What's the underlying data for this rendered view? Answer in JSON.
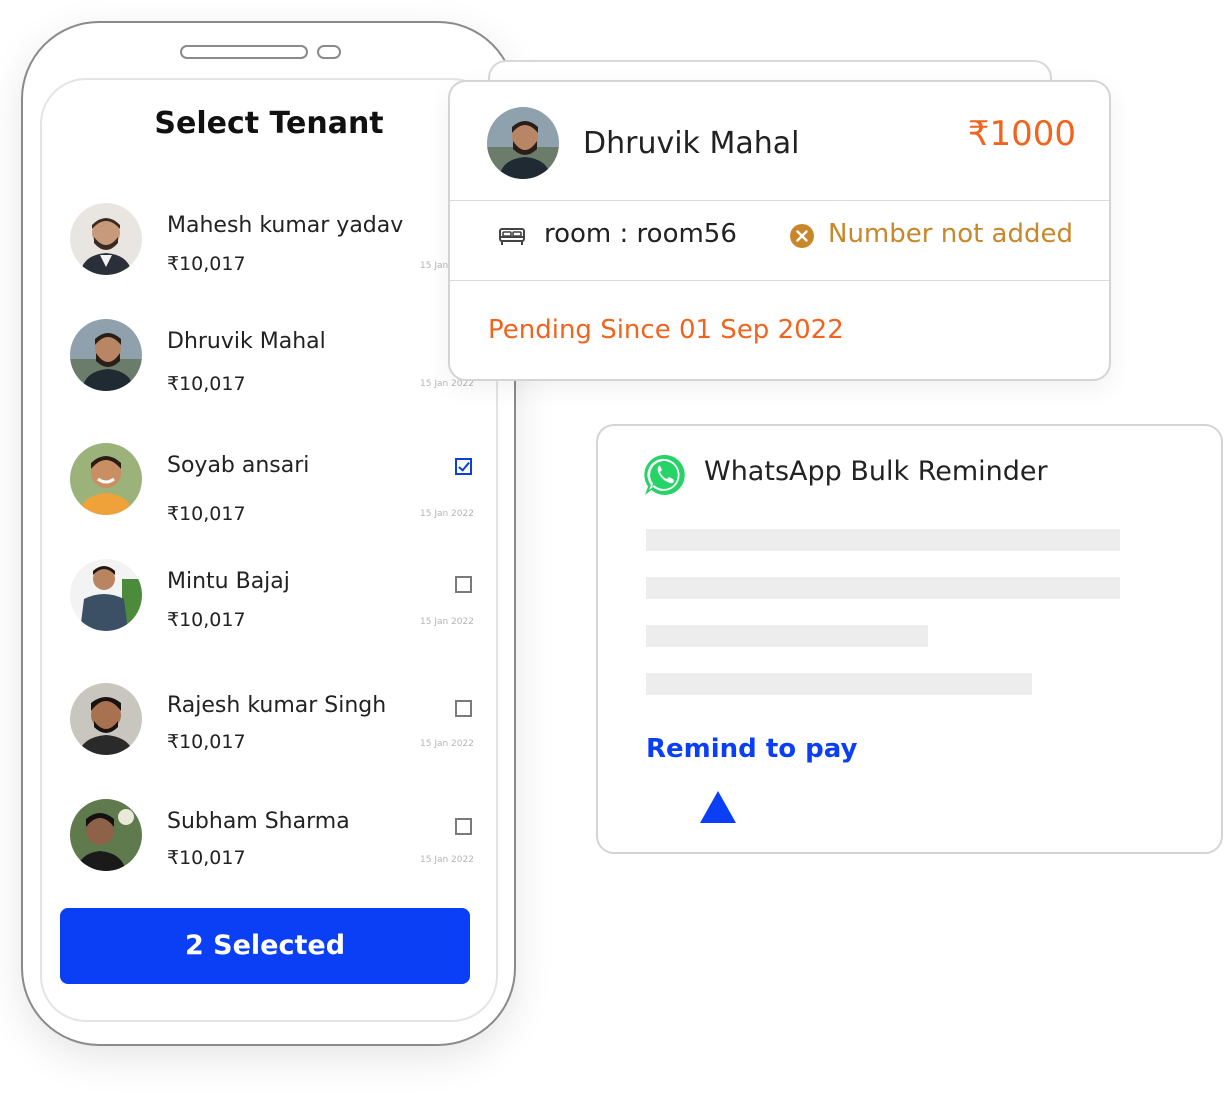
{
  "select_tenant": {
    "title": "Select Tenant",
    "tenants": [
      {
        "name": "Mahesh kumar yadav",
        "amount": "₹10,017",
        "date": "15 Jan",
        "checkbox": "none"
      },
      {
        "name": "Dhruvik Mahal",
        "amount": "₹10,017",
        "date": "15 Jan 2022",
        "checkbox": "none"
      },
      {
        "name": "Soyab ansari",
        "amount": "₹10,017",
        "date": "15 Jan 2022",
        "checkbox": "checked"
      },
      {
        "name": "Mintu Bajaj",
        "amount": "₹10,017",
        "date": "15 Jan 2022",
        "checkbox": "unchecked"
      },
      {
        "name": "Rajesh kumar Singh",
        "amount": "₹10,017",
        "date": "15 Jan 2022",
        "checkbox": "unchecked"
      },
      {
        "name": "Subham Sharma",
        "amount": "₹10,017",
        "date": "15 Jan 2022",
        "checkbox": "unchecked"
      }
    ],
    "selected_button": "2 Selected"
  },
  "tenant_card": {
    "name": "Dhruvik Mahal",
    "amount": "₹1000",
    "room": "room : room56",
    "number_status": "Number not added",
    "pending": "Pending Since 01 Sep 2022"
  },
  "whatsapp_card": {
    "title": "WhatsApp Bulk Reminder",
    "action": "Remind to pay",
    "icon": "whatsapp-icon"
  },
  "colors": {
    "primary": "#0b3ff5",
    "accent_orange": "#f0641e",
    "warning": "#c8872a",
    "whatsapp_green": "#25d366"
  }
}
